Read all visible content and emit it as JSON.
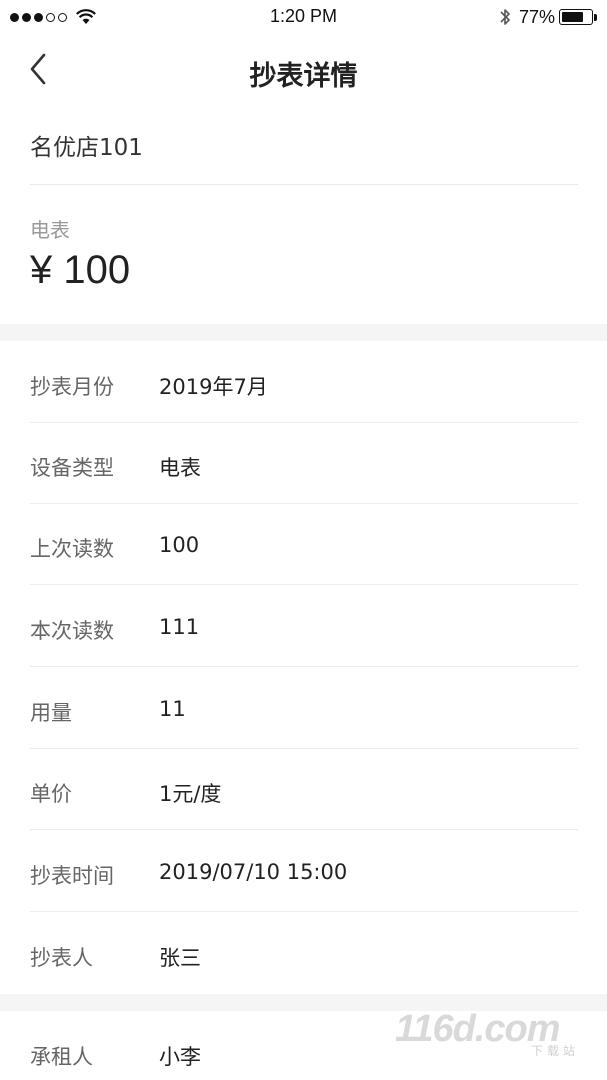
{
  "status_bar": {
    "time": "1:20 PM",
    "battery": "77%",
    "battery_level": 0.77,
    "signal_icon": "signal-dots-icon",
    "wifi_icon": "wifi-icon",
    "bluetooth_icon": "bluetooth-icon"
  },
  "nav": {
    "title": "抄表详情",
    "back_icon": "chevron-left-icon"
  },
  "shop": {
    "name": "名优店101"
  },
  "meter": {
    "type": "电表",
    "amount": "¥ 100"
  },
  "details": [
    {
      "label": "抄表月份",
      "value": "2019年7月"
    },
    {
      "label": "设备类型",
      "value": "电表"
    },
    {
      "label": "上次读数",
      "value": "100"
    },
    {
      "label": "本次读数",
      "value": "111"
    },
    {
      "label": "用量",
      "value": "11"
    },
    {
      "label": "单价",
      "value": "1元/度"
    },
    {
      "label": "抄表时间",
      "value": "2019/07/10 15:00"
    },
    {
      "label": "抄表人",
      "value": "张三"
    }
  ],
  "tenant": {
    "label": "承租人",
    "value": "小李"
  },
  "watermark": {
    "main": "116d.com",
    "sub": "下载站"
  }
}
